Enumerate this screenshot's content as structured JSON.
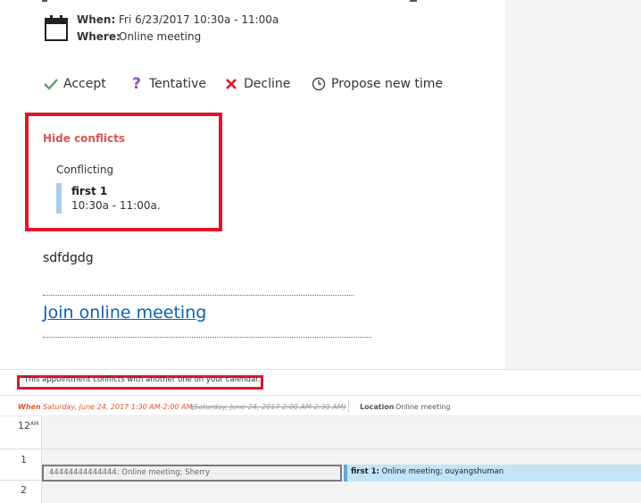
{
  "meeting": {
    "when_label": "When:",
    "when_value": "Fri 6/23/2017 10:30a - 11:00a",
    "where_label": "Where:",
    "where_value": "Online meeting"
  },
  "responses": {
    "accept": "Accept",
    "tentative": "Tentative",
    "decline": "Decline",
    "propose": "Propose new time"
  },
  "conflicts": {
    "toggle_label": "Hide conflicts",
    "section_label": "Conflicting",
    "item_title": "first 1",
    "item_time": "10:30a - 11:00a."
  },
  "body_text": "sdfdgdg",
  "join_link": "Join online meeting",
  "scheduler": {
    "info_text": "This appointment conflicts with another one on your calendar.",
    "when_label": "When",
    "new_time": "Saturday, June 24, 2017 1:30 AM-2:00 AM,",
    "old_time": "(Saturday, June 24, 2017 2:00 AM-2:30 AM)",
    "location_label": "Location",
    "location_value": "Online meeting",
    "hours": {
      "h12": "12",
      "h12_suffix": "AM",
      "h1": "1",
      "h2": "2"
    },
    "appt_current_title": "44444444444444:",
    "appt_current_detail": " Online meeting; Sherry",
    "appt_conflict_title": "first 1:",
    "appt_conflict_detail": " Online meeting; ouyangshuman"
  },
  "colors": {
    "highlight_border": "#e0162b",
    "link": "#0a62b3",
    "accept_icon": "#5aa26a",
    "tentative_icon": "#8a4fb0",
    "decline_icon": "#e0162b",
    "conflict_bar": "#a7cdf0",
    "new_time_text": "#e0552b",
    "conflict_appt_bg": "#c3e4f7"
  },
  "icons": [
    "calendar-icon",
    "checkmark-icon",
    "question-icon",
    "x-icon",
    "clock-icon"
  ]
}
